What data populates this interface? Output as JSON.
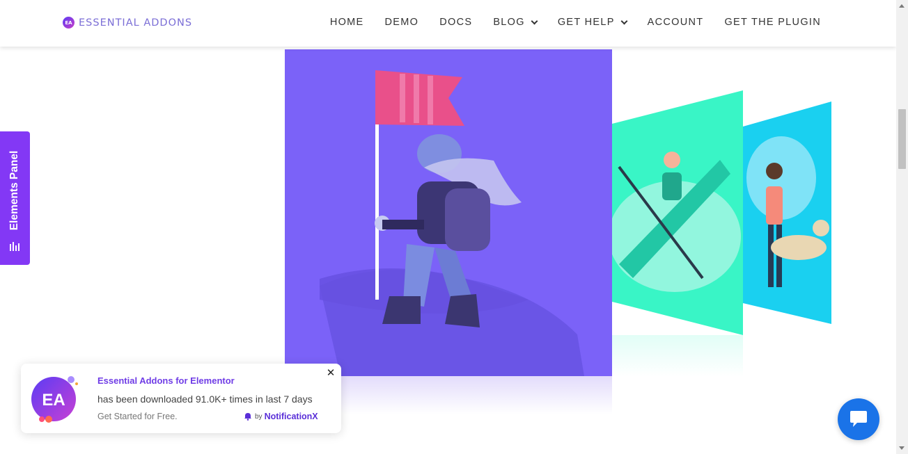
{
  "brand": {
    "logo_mark": "EA",
    "name": "ESSENTIAL ADDONS",
    "accent_color": "#7b6ed6"
  },
  "nav": {
    "items": [
      {
        "label": "HOME",
        "has_dropdown": false
      },
      {
        "label": "DEMO",
        "has_dropdown": false
      },
      {
        "label": "DOCS",
        "has_dropdown": false
      },
      {
        "label": "BLOG",
        "has_dropdown": true
      },
      {
        "label": "GET HELP",
        "has_dropdown": true
      },
      {
        "label": "ACCOUNT",
        "has_dropdown": false
      },
      {
        "label": "GET THE PLUGIN",
        "has_dropdown": false
      }
    ]
  },
  "elements_panel": {
    "label": "Elements Panel",
    "icon": "bar-chart-icon",
    "color": "#8338f5"
  },
  "hero": {
    "bg_color": "#7b62f8",
    "side_card_colors": [
      "#39f5c6",
      "#1ad0f0"
    ]
  },
  "notification": {
    "title": "Essential Addons for Elementor",
    "body": "has been downloaded 91.0K+ times in last 7 days",
    "cta": "Get Started for Free.",
    "by_label": "by",
    "by_brand": "NotificationX",
    "close_icon": "close-icon"
  },
  "chat": {
    "icon": "chat-bubble-icon",
    "color": "#1a73e8"
  }
}
